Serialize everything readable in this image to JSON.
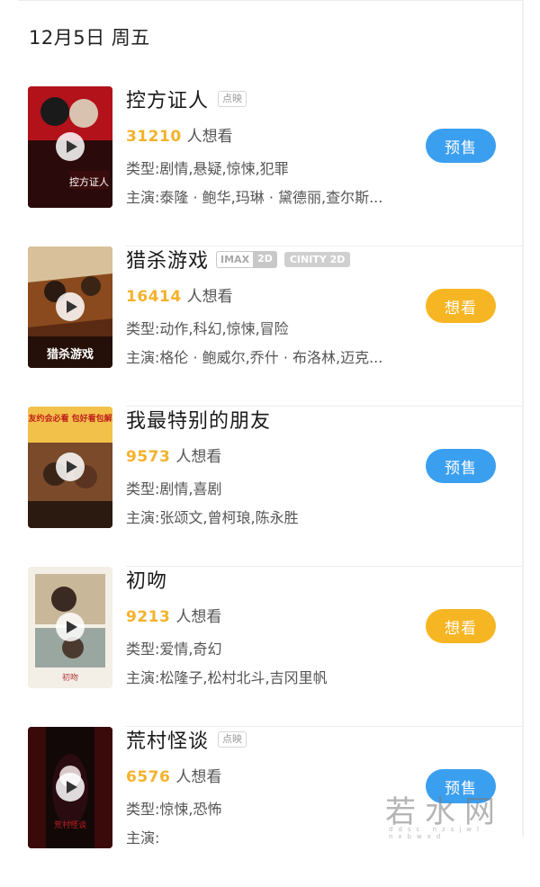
{
  "header": {
    "date": "12月5日 周五"
  },
  "movies": [
    {
      "title": "控方证人",
      "tag": "点映",
      "want_count": "31210",
      "want_suffix": "人想看",
      "type": "类型:剧情,悬疑,惊悚,犯罪",
      "cast": "主演:泰隆 · 鲍华,玛琳 · 黛德丽,查尔斯...",
      "button": "预售",
      "button_color": "#3b9ff0",
      "poster_text": "控方证人"
    },
    {
      "title": "猎杀游戏",
      "formats": [
        {
          "a": "IMAX",
          "b": "2D"
        },
        {
          "single": "CINITY 2D"
        }
      ],
      "want_count": "16414",
      "want_suffix": "人想看",
      "type": "类型:动作,科幻,惊悚,冒险",
      "cast": "主演:格伦 · 鲍威尔,乔什 · 布洛林,迈克...",
      "button": "想看",
      "button_color": "#f6b624",
      "poster_text": "猎杀游戏"
    },
    {
      "title": "我最特别的朋友",
      "want_count": "9573",
      "want_suffix": "人想看",
      "type": "类型:剧情,喜剧",
      "cast": "主演:张颂文,曾柯琅,陈永胜",
      "button": "预售",
      "button_color": "#3b9ff0",
      "poster_text": "朋友约会必看 包好看包解压"
    },
    {
      "title": "初吻",
      "want_count": "9213",
      "want_suffix": "人想看",
      "type": "类型:爱情,奇幻",
      "cast": "主演:松隆子,松村北斗,吉冈里帆",
      "button": "想看",
      "button_color": "#f6b624",
      "poster_text": "初吻"
    },
    {
      "title": "荒村怪谈",
      "tag": "点映",
      "want_count": "6576",
      "want_suffix": "人想看",
      "type": "类型:惊悚,恐怖",
      "cast": "主演:",
      "button": "预售",
      "button_color": "#3b9ff0",
      "poster_text": "荒村怪谈"
    }
  ],
  "watermark": {
    "main": "若水网",
    "sub": "ddsc nzsjwl  nxbwxd"
  }
}
